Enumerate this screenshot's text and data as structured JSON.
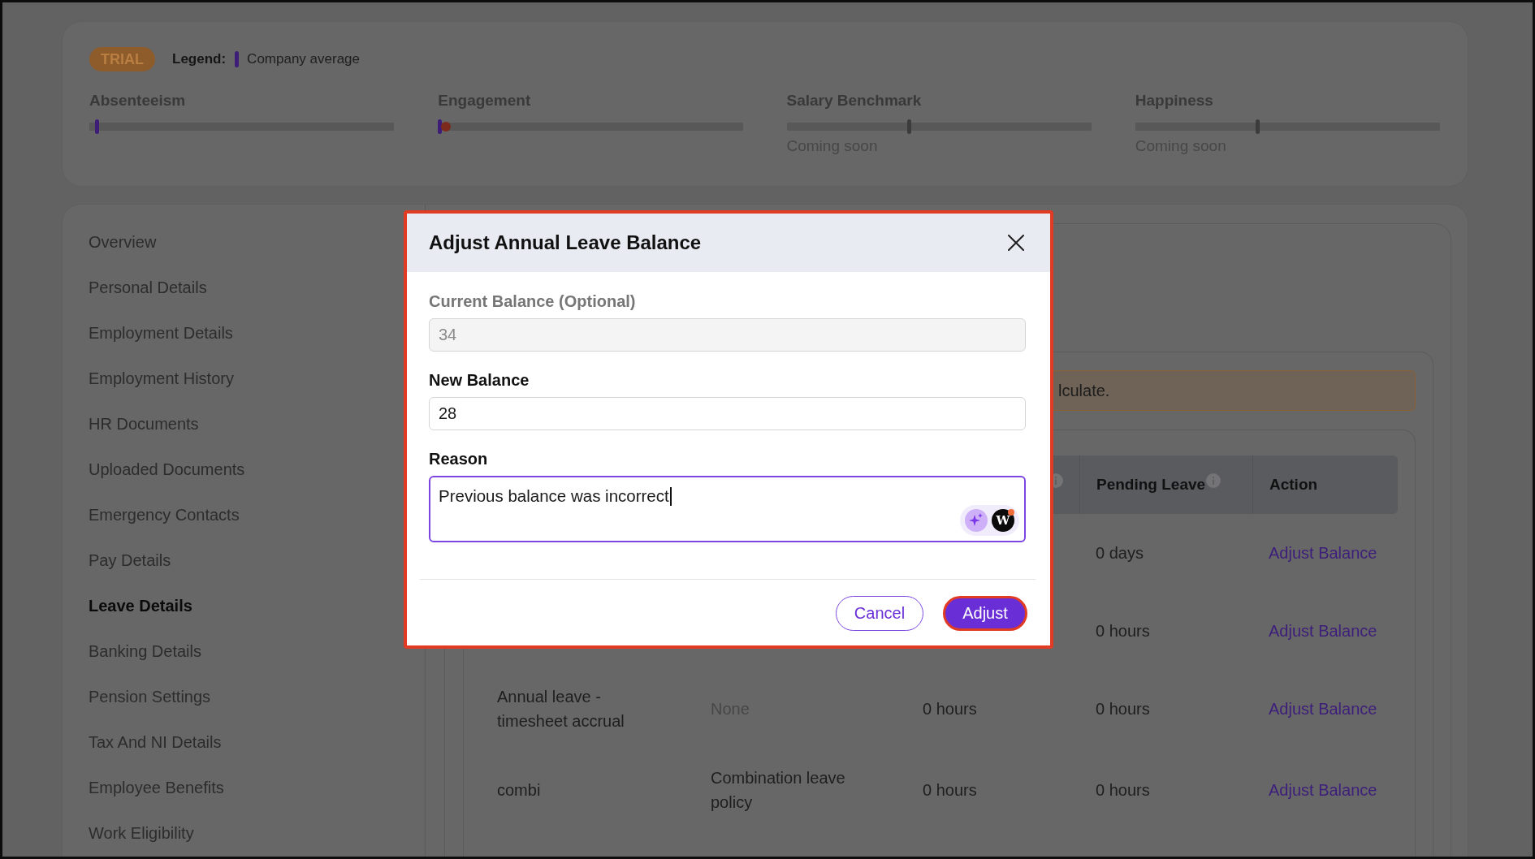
{
  "top_panel": {
    "badge": "TRIAL",
    "legend": {
      "label": "Legend:",
      "text": "Company average"
    },
    "metrics": [
      {
        "title": "Absenteeism",
        "disabled": false,
        "average_marker": {
          "level": 0.02
        }
      },
      {
        "title": "Engagement",
        "disabled": false,
        "average_marker": {
          "level": 0.0
        },
        "score_marker": {
          "level": 0.01
        }
      },
      {
        "title": "Salary Benchmark",
        "disabled": true,
        "average_marker": {
          "level": 0.4
        },
        "note": "Coming soon"
      },
      {
        "title": "Happiness",
        "disabled": true,
        "average_marker": {
          "level": 0.4
        },
        "note": "Coming soon"
      }
    ]
  },
  "sidebar": {
    "items": [
      {
        "label": "Overview",
        "selected": false
      },
      {
        "label": "Personal Details",
        "selected": false
      },
      {
        "label": "Employment Details",
        "selected": false
      },
      {
        "label": "Employment History",
        "selected": false
      },
      {
        "label": "HR Documents",
        "selected": false
      },
      {
        "label": "Uploaded Documents",
        "selected": false
      },
      {
        "label": "Emergency Contacts",
        "selected": false
      },
      {
        "label": "Pay Details",
        "selected": false
      },
      {
        "label": "Leave Details",
        "selected": true
      },
      {
        "label": "Banking Details",
        "selected": false
      },
      {
        "label": "Pension Settings",
        "selected": false
      },
      {
        "label": "Tax And NI Details",
        "selected": false
      },
      {
        "label": "Employee Benefits",
        "selected": false
      },
      {
        "label": "Work Eligibility",
        "selected": false
      }
    ]
  },
  "content": {
    "banner": {
      "text": "lculate."
    },
    "table": {
      "columns": [
        null,
        null,
        {
          "info": true
        },
        {
          "label": "Pending Leave",
          "info": true
        },
        {
          "label": "Action",
          "info": false
        }
      ],
      "rows": [
        {
          "cells": [
            null,
            null,
            null,
            {
              "kind": "text",
              "text": "0 days"
            },
            {
              "kind": "link",
              "text": "Adjust Balance"
            }
          ]
        },
        {
          "cells": [
            null,
            null,
            null,
            {
              "kind": "text",
              "text": "0 hours"
            },
            {
              "kind": "link",
              "text": "Adjust Balance"
            }
          ]
        },
        {
          "cells": [
            {
              "kind": "text",
              "text": "Annual leave - timesheet accrual"
            },
            {
              "kind": "muted",
              "text": "None"
            },
            {
              "kind": "text",
              "text": "0 hours"
            },
            {
              "kind": "text",
              "text": "0 hours"
            },
            {
              "kind": "link",
              "text": "Adjust Balance"
            }
          ]
        },
        {
          "cells": [
            {
              "kind": "text",
              "text": "combi"
            },
            {
              "kind": "text",
              "text": "Combination leave policy"
            },
            {
              "kind": "text",
              "text": "0 hours"
            },
            {
              "kind": "text",
              "text": "0 hours"
            },
            {
              "kind": "link",
              "text": "Adjust Balance"
            }
          ]
        }
      ]
    }
  },
  "dialog": {
    "title": "Adjust Annual Leave Balance",
    "highlighted": true,
    "fields": [
      {
        "kind": "input",
        "label": "Current Balance (Optional)",
        "value": "34",
        "disabled": true,
        "focused": false
      },
      {
        "kind": "input",
        "label": "New Balance",
        "value": "28",
        "disabled": false,
        "focused": false
      },
      {
        "kind": "textarea",
        "label": "Reason",
        "value": "Previous balance was incorrect",
        "disabled": false,
        "focused": true,
        "assistant": {
          "letter": "W",
          "notification": true
        }
      }
    ],
    "buttons": [
      {
        "kind": "secondary",
        "label": "Cancel",
        "highlighted": false
      },
      {
        "kind": "primary",
        "label": "Adjust",
        "highlighted": true
      }
    ]
  }
}
